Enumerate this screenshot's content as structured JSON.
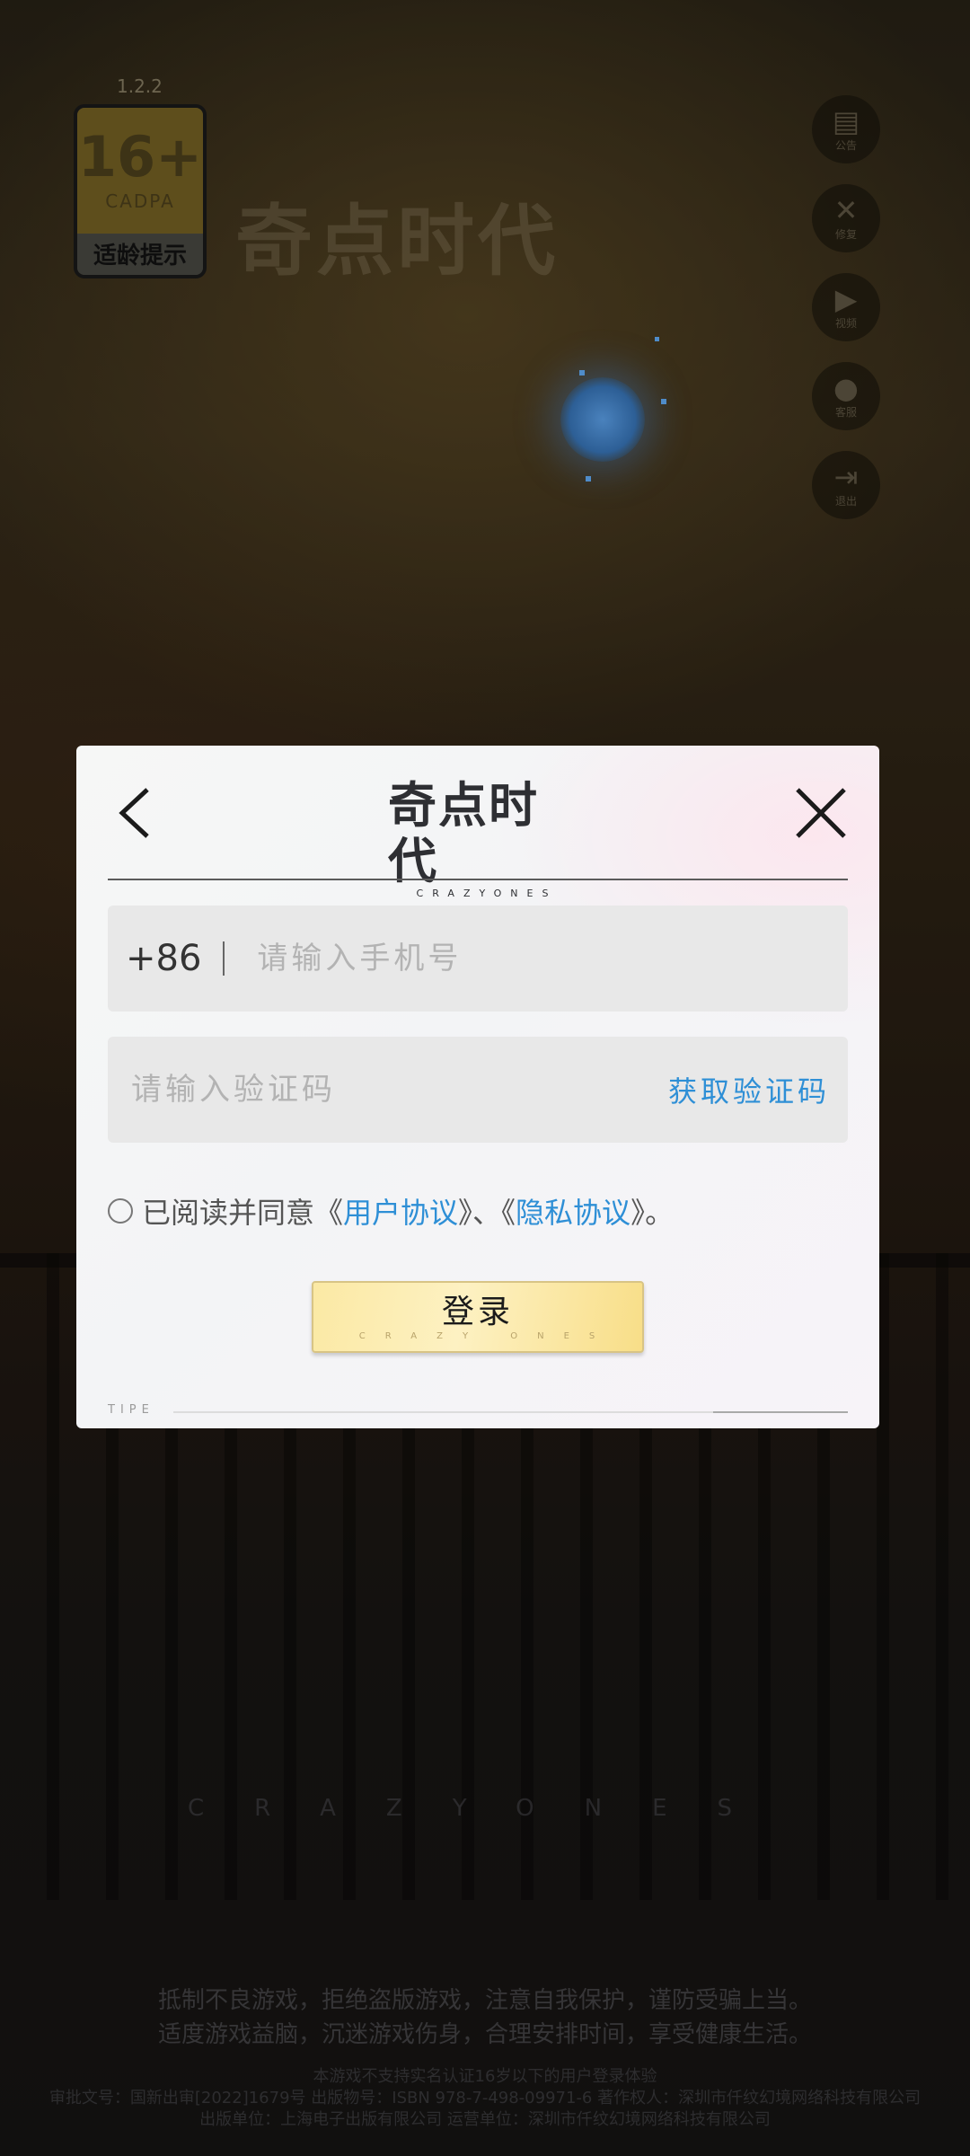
{
  "app": {
    "version": "1.2.2",
    "age_badge": {
      "rating": "16+",
      "org": "CADPA",
      "label": "适龄提示"
    },
    "logo_cn": "奇点时代",
    "logo_en": "CRAZYONES"
  },
  "side_buttons": [
    {
      "icon": "notice-icon",
      "label": "公告"
    },
    {
      "icon": "repair-icon",
      "label": "修复"
    },
    {
      "icon": "video-icon",
      "label": "视频"
    },
    {
      "icon": "service-icon",
      "label": "客服"
    },
    {
      "icon": "logout-icon",
      "label": "退出"
    }
  ],
  "dialog": {
    "logo_cn": "奇点时代",
    "logo_en": "CRAZYONES",
    "phone": {
      "prefix": "+86",
      "placeholder": "请输入手机号",
      "value": ""
    },
    "code": {
      "placeholder": "请输入验证码",
      "value": "",
      "get_code_label": "获取验证码"
    },
    "agreement": {
      "checked": false,
      "text_before": "已阅读并同意《",
      "user_agreement": "用户协议",
      "text_middle": "》、《",
      "privacy_policy": "隐私协议",
      "text_after": "》。"
    },
    "login": {
      "label": "登录",
      "sublabel": "CRAZY ONES"
    },
    "footer_tag": "TIPE"
  },
  "background": {
    "brand_line": "CRAZYONES",
    "health_notice": [
      "抵制不良游戏，拒绝盗版游戏，注意自我保护，谨防受骗上当。",
      "适度游戏益脑，沉迷游戏伤身，合理安排时间，享受健康生活。"
    ],
    "legal": [
      "本游戏不支持实名认证16岁以下的用户登录体验",
      "审批文号：国新出审[2022]1679号 出版物号：ISBN 978-7-498-09971-6 著作权人：深圳市仟纹幻境网络科技有限公司",
      "出版单位：上海电子出版有限公司 运营单位：深圳市仟纹幻境网络科技有限公司"
    ]
  },
  "colors": {
    "accent": "#2e8fd6",
    "button_gold": "#fbe9a4",
    "dialog_bg": "#f4f5f6"
  }
}
